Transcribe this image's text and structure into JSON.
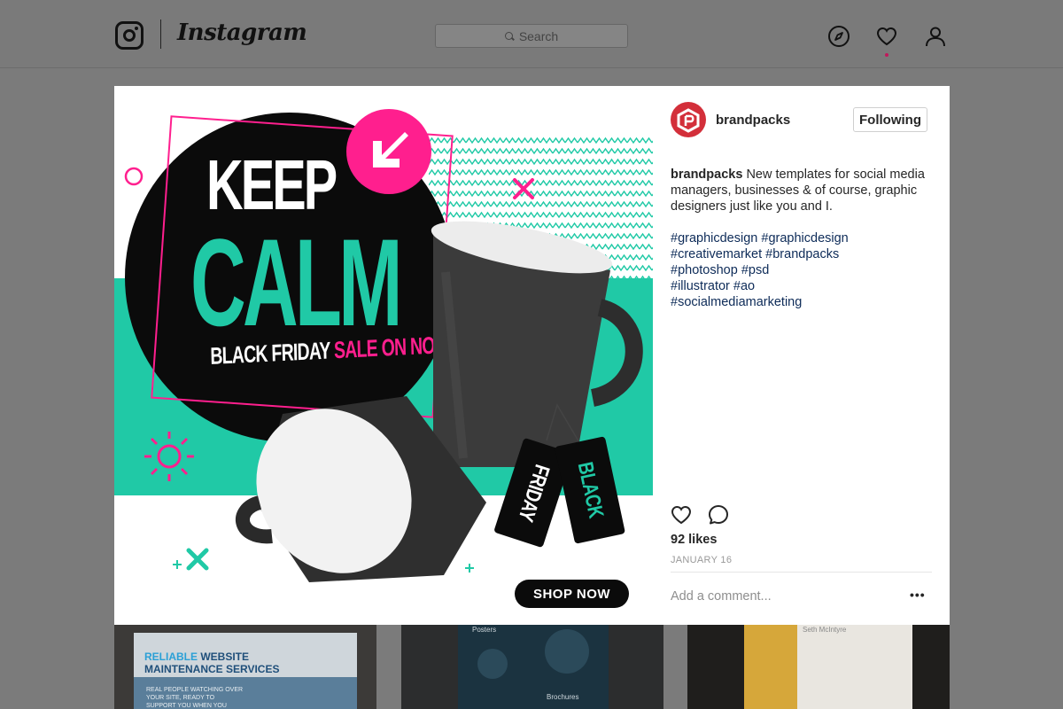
{
  "nav": {
    "app_name": "Instagram",
    "search_placeholder": "Search",
    "icons": [
      "instagram-glyph-icon",
      "compass-icon",
      "heart-icon",
      "profile-icon"
    ]
  },
  "post": {
    "headline_1": "KEEP",
    "headline_2": "CALM",
    "subline_white": "BLACK FRIDAY",
    "subline_pink": "SALE ON NOW",
    "tag_1": "FRIDAY",
    "tag_2": "BLACK",
    "cta": "SHOP NOW"
  },
  "sidebar": {
    "username": "brandpacks",
    "follow_label": "Following",
    "caption_user": "brandpacks",
    "caption_text": "New templates for social media managers, businesses & of course, graphic designers just like you and I.",
    "hashtag_lines": [
      "#graphicdesign #graphicdesign",
      "#creativemarket #brandpacks",
      "#photoshop #psd",
      "#illustrator #ao",
      "#socialmediamarketing"
    ],
    "likes": "92 likes",
    "date": "JANUARY 16",
    "comment_placeholder": "Add a comment...",
    "more_label": "•••"
  },
  "feed": {
    "thumb_1_heading_a": "RELIABLE",
    "thumb_1_heading_b": "WEBSITE",
    "thumb_1_heading_c": "MAINTENANCE SERVICES",
    "thumb_1_text": "REAL PEOPLE WATCHING OVER YOUR SITE, READY TO SUPPORT YOU WHEN YOU NEED IT",
    "thumb_2_label_1": "Posters",
    "thumb_2_label_2": "Brochures",
    "thumb_3_name": "Seth McIntyre"
  },
  "colors": {
    "teal": "#20c9a6",
    "pink": "#ff1f8e",
    "black": "#0b0b0b",
    "hashtag": "#0d2b58",
    "avatar_red": "#d32f3a"
  }
}
